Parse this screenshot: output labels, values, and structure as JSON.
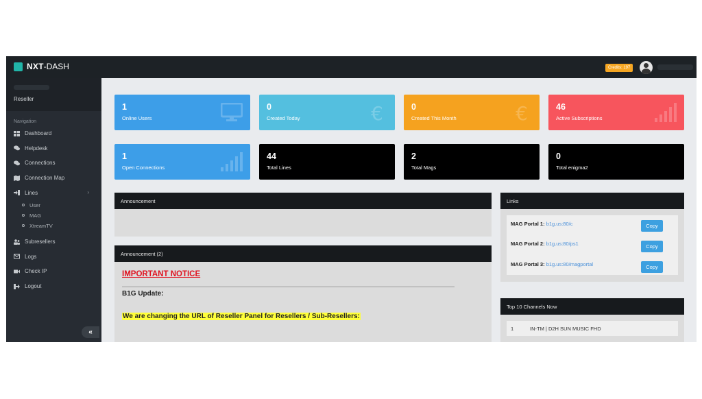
{
  "brand": {
    "bold": "NXT",
    "light": "-DASH"
  },
  "topbar": {
    "credits": "Credits: 197"
  },
  "sidebar": {
    "role": "Reseller",
    "nav_title": "Navigation",
    "items": [
      {
        "label": "Dashboard",
        "icon": "dashboard-icon"
      },
      {
        "label": "Helpdesk",
        "icon": "chat-icon"
      },
      {
        "label": "Connections",
        "icon": "chat-icon"
      },
      {
        "label": "Connection Map",
        "icon": "map-icon"
      },
      {
        "label": "Lines",
        "icon": "login-icon"
      },
      {
        "label": "Subresellers",
        "icon": "users-icon"
      },
      {
        "label": "Logs",
        "icon": "envelope-icon"
      },
      {
        "label": "Check IP",
        "icon": "video-icon"
      },
      {
        "label": "Logout",
        "icon": "logout-icon"
      }
    ],
    "lines_sub": [
      "User",
      "MAG",
      "XtreamTV"
    ],
    "collapse": "«"
  },
  "stats": [
    {
      "value": "1",
      "label": "Online Users",
      "color": "#3d9ee8",
      "icon": "monitor-icon"
    },
    {
      "value": "0",
      "label": "Created Today",
      "color": "#54bfdf",
      "icon": "euro-icon"
    },
    {
      "value": "0",
      "label": "Created This Month",
      "color": "#f5a21f",
      "icon": "euro-icon"
    },
    {
      "value": "46",
      "label": "Active Subscriptions",
      "color": "#f7555d",
      "icon": "signal-icon"
    },
    {
      "value": "1",
      "label": "Open Connections",
      "color": "#3d9ee8",
      "icon": "signal-icon"
    },
    {
      "value": "44",
      "label": "Total Lines",
      "color": "#000000"
    },
    {
      "value": "2",
      "label": "Total Mags",
      "color": "#000000"
    },
    {
      "value": "0",
      "label": "Total enigma2",
      "color": "#000000"
    }
  ],
  "announcement": {
    "title": "Announcement"
  },
  "announcement2": {
    "title": "Announcement (2)",
    "notice": "IMPORTANT NOTICE",
    "update": "B1G Update:",
    "highlight": "We are changing the URL of Reseller Panel for Resellers / Sub-Resellers:"
  },
  "links": {
    "title": "Links",
    "rows": [
      {
        "label": "MAG Portal 1:",
        "url": "b1g.us:80/c",
        "button": "Copy"
      },
      {
        "label": "MAG Portal 2:",
        "url": "b1g.us:80/ps1",
        "button": "Copy"
      },
      {
        "label": "MAG Portal 3:",
        "url": "b1g.us:80/magportal",
        "button": "Copy"
      }
    ]
  },
  "top_channels": {
    "title": "Top 10 Channels Now",
    "rows": [
      {
        "rank": "1",
        "name": "IN-TM | D2H SUN MUSIC FHD"
      }
    ]
  }
}
